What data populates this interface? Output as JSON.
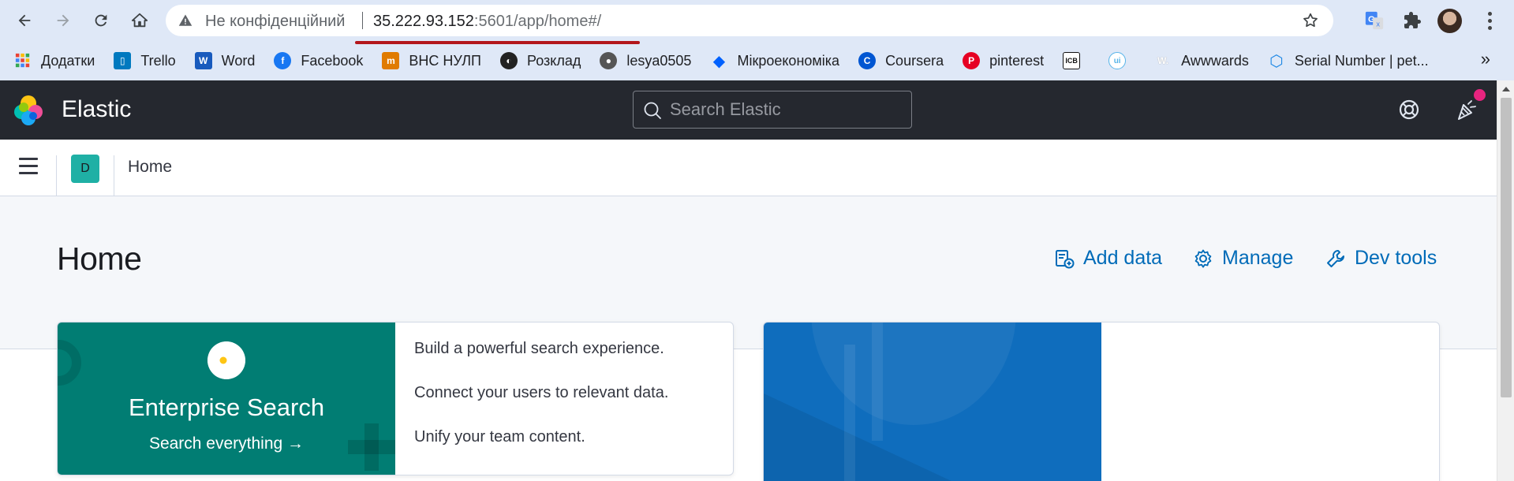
{
  "browser": {
    "security_status": "Не конфіденційний",
    "url_host": "35.222.93.152",
    "url_rest": ":5601/app/home#/",
    "bookmarks": [
      {
        "label": "Додатки",
        "icon": "apps-grid-icon",
        "color": "#ea4335"
      },
      {
        "label": "Trello",
        "icon": "trello-icon",
        "color": "#0079bf"
      },
      {
        "label": "Word",
        "icon": "word-icon",
        "color": "#185abd"
      },
      {
        "label": "Facebook",
        "icon": "facebook-icon",
        "color": "#1877f2"
      },
      {
        "label": "ВНС НУЛП",
        "icon": "vns-icon",
        "color": "#e07b00"
      },
      {
        "label": "Розклад",
        "icon": "globe-icon",
        "color": "#222222"
      },
      {
        "label": "lesya0505",
        "icon": "github-icon",
        "color": "#555555"
      },
      {
        "label": "Мікроекономіка",
        "icon": "dropbox-icon",
        "color": "#0061fe"
      },
      {
        "label": "Coursera",
        "icon": "coursera-icon",
        "color": "#0056d2"
      },
      {
        "label": "pinterest",
        "icon": "pinterest-icon",
        "color": "#e60023"
      },
      {
        "label": "",
        "icon": "icb-icon",
        "color": "#111111"
      },
      {
        "label": "",
        "icon": "ui-icon",
        "color": "#56b4e9"
      },
      {
        "label": "Awwwards",
        "icon": "awwwards-icon",
        "color": "#ffffff"
      },
      {
        "label": "Serial Number | pet...",
        "icon": "hexagon-icon",
        "color": "#1e88e5"
      }
    ],
    "bookmarks_overflow": "»"
  },
  "kibana": {
    "brand": "Elastic",
    "search_placeholder": "Search Elastic",
    "breadcrumb_space_initial": "D",
    "breadcrumb": "Home",
    "colors": {
      "header_bg": "#25282f",
      "link": "#006bb8",
      "enterprise_search_green": "#017d73",
      "observability_blue": "#0f6dbd",
      "notification_dot": "#e7247f"
    }
  },
  "page": {
    "title": "Home",
    "header_links": {
      "add_data": "Add data",
      "manage": "Manage",
      "dev_tools": "Dev tools"
    },
    "enterprise_search": {
      "title": "Enterprise Search",
      "link": "Search everything →",
      "points": [
        "Build a powerful search experience.",
        "Connect your users to relevant data.",
        "Unify your team content."
      ]
    }
  }
}
